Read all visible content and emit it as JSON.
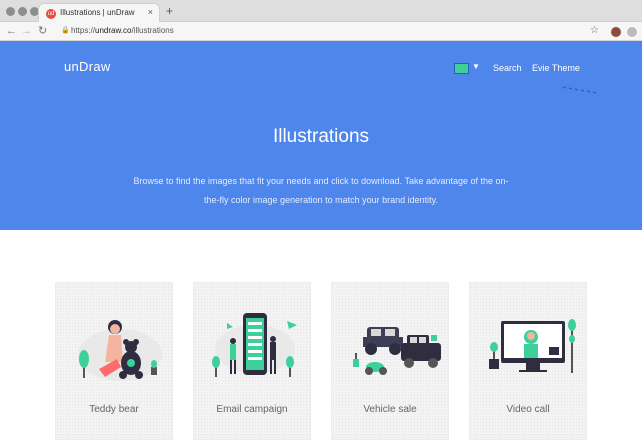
{
  "browser": {
    "tab_title": "Illustrations | unDraw",
    "tab_favicon": "ud",
    "tab_close": "×",
    "new_tab": "+",
    "url_scheme": "https://",
    "url_host": "undraw.co",
    "url_path": "/illustrations",
    "icons": {
      "back": "back-arrow-icon",
      "forward": "forward-arrow-icon",
      "reload": "reload-icon",
      "lock": "lock-icon",
      "star": "star-icon"
    }
  },
  "header": {
    "logo": "unDraw",
    "color_picker_value": "#3ed09b",
    "nav": {
      "search": "Search",
      "theme": "Evie Theme"
    }
  },
  "hero": {
    "title": "Illustrations",
    "subtitle": "Browse to find the images that fit your needs and click to download. Take advantage of the on-the-fly color image generation to match your brand identity."
  },
  "cards": [
    {
      "label": "Teddy bear"
    },
    {
      "label": "Email campaign"
    },
    {
      "label": "Vehicle sale"
    },
    {
      "label": "Video call"
    }
  ],
  "colors": {
    "hero_blue": "#4f86ec",
    "accent_green": "#3ed09b",
    "card_bg": "#f3f3f3"
  }
}
